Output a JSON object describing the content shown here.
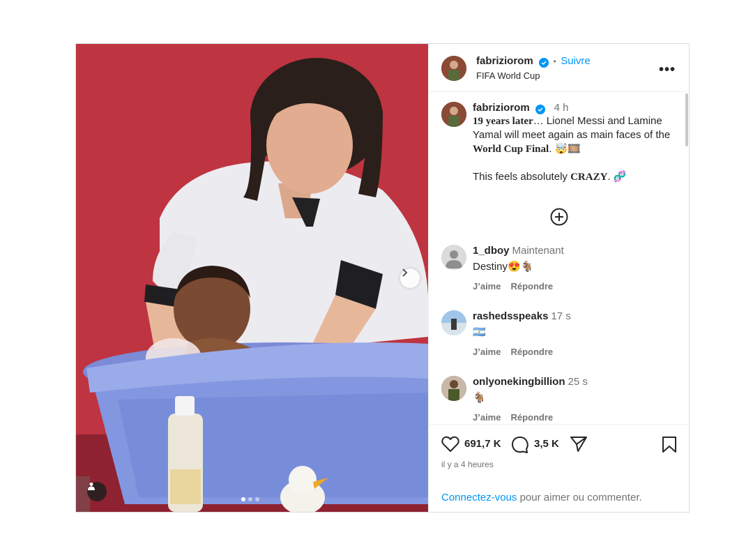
{
  "post": {
    "author": "fabriziorom",
    "follow_label": "Suivre",
    "separator": "•",
    "location": "FIFA World Cup",
    "more_label": "•••"
  },
  "caption": {
    "author": "fabriziorom",
    "time": "4 h",
    "line1_bold": "19 years later",
    "line1_rest": "… Lionel Messi and Lamine Yamal will meet again as main faces of the ",
    "line1_bold2": "World Cup Final",
    "line1_end": ". 🤯🎞️",
    "line2_start": "This feels absolutely ",
    "line2_bold": "CRAZY",
    "line2_end": ". 🧬"
  },
  "comments": [
    {
      "user": "1_dboy",
      "time": "Maintenant",
      "text": "Destiny😍🐐",
      "like": "J’aime",
      "reply": "Répondre"
    },
    {
      "user": "rashedsspeaks",
      "time": "17 s",
      "text": "🇦🇷",
      "like": "J’aime",
      "reply": "Répondre"
    },
    {
      "user": "onlyonekingbillion",
      "time": "25 s",
      "text": "🐐",
      "like": "J’aime",
      "reply": "Répondre"
    }
  ],
  "stats": {
    "likes": "691,7 K",
    "comments": "3,5 K",
    "ago": "il y a 4 heures"
  },
  "login": {
    "link": "Connectez-vous",
    "rest": " pour aimer ou commenter."
  },
  "carousel": {
    "slides": 3,
    "active_index": 0
  },
  "colors": {
    "accent": "#0095f6",
    "background": "#c8343f"
  }
}
